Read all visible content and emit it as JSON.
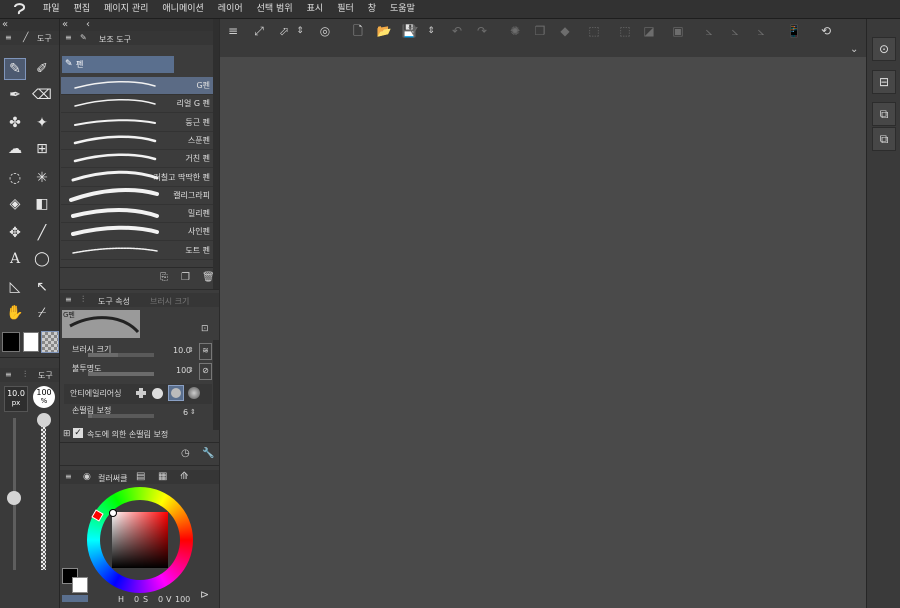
{
  "menubar": {
    "items": [
      "파일",
      "편집",
      "페이지 관리",
      "애니메이션",
      "레이어",
      "선택 범위",
      "표시",
      "필터",
      "창",
      "도움말"
    ]
  },
  "tool_palette": {
    "tab_label": "도구",
    "tools": [
      {
        "icon": "pen-icon",
        "selected": true
      },
      {
        "icon": "pencil-icon",
        "selected": false
      },
      {
        "icon": "brush-icon",
        "selected": false
      },
      {
        "icon": "eraser-icon",
        "selected": false
      },
      {
        "icon": "decoration-icon",
        "selected": false
      },
      {
        "icon": "sparkle-icon",
        "selected": false
      },
      {
        "icon": "blend-icon",
        "selected": false
      },
      {
        "icon": "grid-icon",
        "selected": false
      },
      {
        "icon": "lasso-icon",
        "selected": false
      },
      {
        "icon": "magic-wand-icon",
        "selected": false
      },
      {
        "icon": "fill-icon",
        "selected": false
      },
      {
        "icon": "gradient-icon",
        "selected": false
      },
      {
        "icon": "move-icon",
        "selected": false
      },
      {
        "icon": "line-icon",
        "selected": false
      },
      {
        "icon": "text-icon",
        "selected": false
      },
      {
        "icon": "balloon-icon",
        "selected": false
      },
      {
        "icon": "frame-border-icon",
        "selected": false
      },
      {
        "icon": "operation-icon",
        "selected": false
      },
      {
        "icon": "hand-icon",
        "selected": false
      },
      {
        "icon": "eyedropper-icon",
        "selected": false
      }
    ]
  },
  "brush_size_panel": {
    "tab_label": "도구",
    "size_value": "10.0",
    "size_unit": "px",
    "opacity_value": "100",
    "opacity_unit": "%"
  },
  "subtool_panel": {
    "tab_label": "보조 도구",
    "group_label": "펜",
    "brushes": [
      {
        "name": "G펜",
        "selected": true
      },
      {
        "name": "리얼 G 펜",
        "selected": false
      },
      {
        "name": "둥근 펜",
        "selected": false
      },
      {
        "name": "스푼펜",
        "selected": false
      },
      {
        "name": "거친 펜",
        "selected": false
      },
      {
        "name": "거칠고 딱딱한 펜",
        "selected": false
      },
      {
        "name": "캘리그라피",
        "selected": false
      },
      {
        "name": "밀리펜",
        "selected": false
      },
      {
        "name": "사인펜",
        "selected": false
      },
      {
        "name": "도트 펜",
        "selected": false
      }
    ]
  },
  "tool_property": {
    "tab_label": "도구 속성",
    "tab2_label": "브러시 크기",
    "preview_label": "G펜",
    "props": [
      {
        "label": "브러시 크기",
        "value": "10.0",
        "fill": 0.45
      },
      {
        "label": "불투명도",
        "value": "100",
        "fill": 1.0
      },
      {
        "label": "안티에일리어싱",
        "value": ""
      },
      {
        "label": "손떨림 보정",
        "value": "6",
        "fill": 0.06
      }
    ],
    "checkbox_label": "속도에 의한 손떨림 보정"
  },
  "color_panel": {
    "tab_label": "컬러써클",
    "readout": {
      "h": "0",
      "s": "0",
      "v": "100"
    }
  },
  "colors": {
    "accent": "#7f95bb",
    "canvas": "#4a4a4a"
  }
}
